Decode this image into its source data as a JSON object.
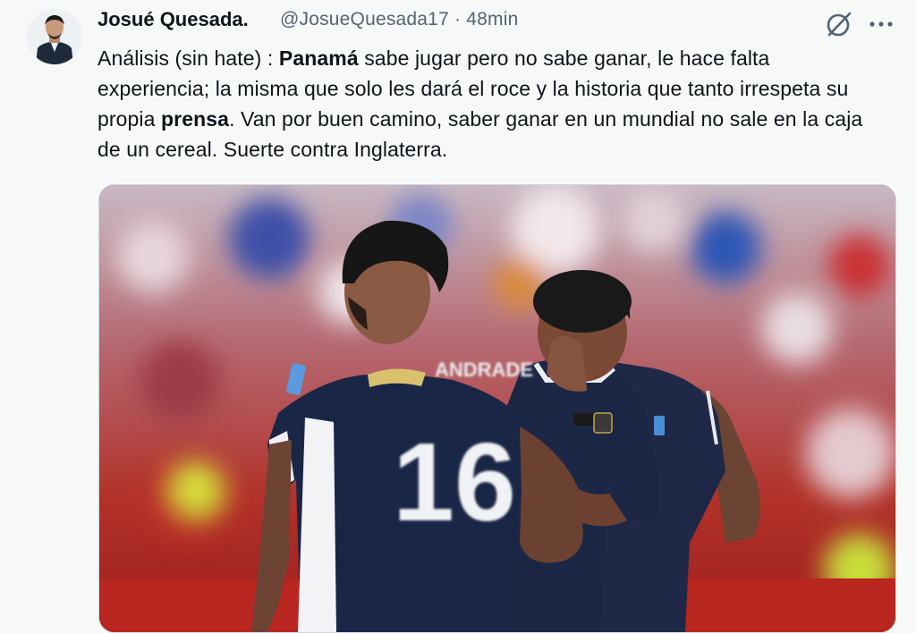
{
  "author": {
    "display_name": "Josué Quesada.",
    "handle": "@JosueQuesada17",
    "separator": "·",
    "time": "48min"
  },
  "tweet": {
    "segments": [
      {
        "text": "Análisis (sin hate) : ",
        "bold": false
      },
      {
        "text": "Panamá",
        "bold": true
      },
      {
        "text": " sabe jugar pero no sabe ganar, le hace falta experiencia; la misma que solo les dará el roce y la historia que tanto irrespeta su propia ",
        "bold": false
      },
      {
        "text": "prensa",
        "bold": true
      },
      {
        "text": ". Van por buen camino, saber ganar en un mundial no sale en la caja de un  cereal. Suerte contra Inglaterra.",
        "bold": false
      }
    ]
  },
  "media": {
    "jersey_name": "ANDRADE",
    "jersey_number": "16"
  },
  "icons": {
    "grok": "grok-icon",
    "more": "more-options-icon"
  },
  "colors": {
    "text": "#0f1419",
    "secondary": "#536471",
    "background": "#f7f9f9"
  }
}
